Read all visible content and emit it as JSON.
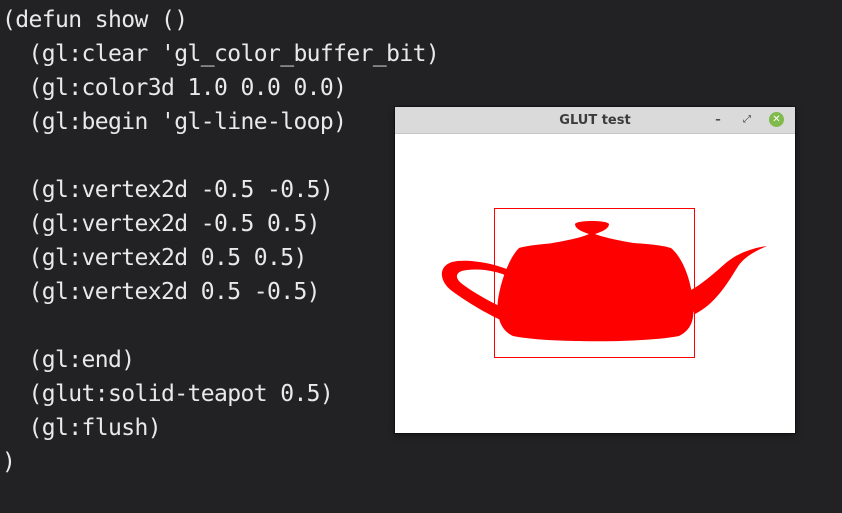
{
  "editor": {
    "lines": [
      "(defun show ()",
      "  (gl:clear 'gl_color_buffer_bit)",
      "  (gl:color3d 1.0 0.0 0.0)",
      "  (gl:begin 'gl-line-loop)",
      "",
      "  (gl:vertex2d -0.5 -0.5)",
      "  (gl:vertex2d -0.5 0.5)",
      "  (gl:vertex2d 0.5 0.5)",
      "  (gl:vertex2d 0.5 -0.5)",
      "",
      "  (gl:end)",
      "  (glut:solid-teapot 0.5)",
      "  (gl:flush)",
      ")"
    ]
  },
  "glut_window": {
    "title": "GLUT test",
    "buttons": {
      "minimize_icon": "minimize-icon",
      "maximize_icon": "maximize-icon",
      "close_icon": "close-icon"
    },
    "render": {
      "draw_color": "#ff0000",
      "background": "#ffffff",
      "shapes": [
        "line-loop-square",
        "solid-teapot"
      ]
    }
  }
}
